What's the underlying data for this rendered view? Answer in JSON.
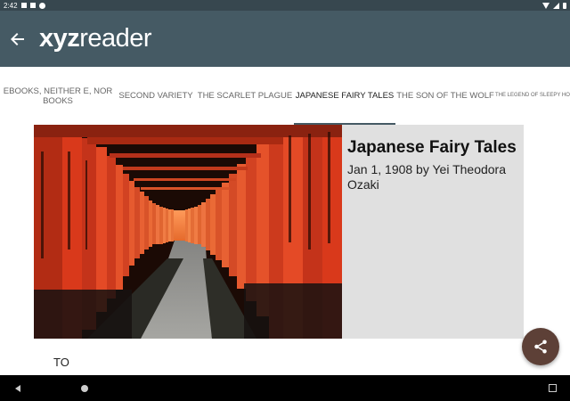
{
  "status_bar": {
    "time": "2:42"
  },
  "app_bar": {
    "logo_prefix": "xyz",
    "logo_suffix": "reader"
  },
  "tabs": [
    {
      "label": "EBOOKS, NEITHER E, NOR BOOKS"
    },
    {
      "label": "SECOND VARIETY"
    },
    {
      "label": "THE SCARLET PLAGUE"
    },
    {
      "label": "JAPANESE FAIRY TALES"
    },
    {
      "label": "THE SON OF THE WOLF"
    },
    {
      "label": "THE LEGEND OF SLEEPY HOLLOW"
    }
  ],
  "article": {
    "title": "Japanese Fairy Tales",
    "byline": "Jan 1, 1908 by Yei Theodora Ozaki",
    "body_start": "TO"
  },
  "colors": {
    "app_bar": "#455a64",
    "status_bar": "#37474f",
    "fab": "#5d4037",
    "gate_red": "#e0421e",
    "card_bg": "#e0e0e0"
  },
  "icons": {
    "back": "arrow-left",
    "share": "share",
    "nav_back": "triangle-left",
    "nav_home": "circle",
    "nav_recent": "square"
  }
}
